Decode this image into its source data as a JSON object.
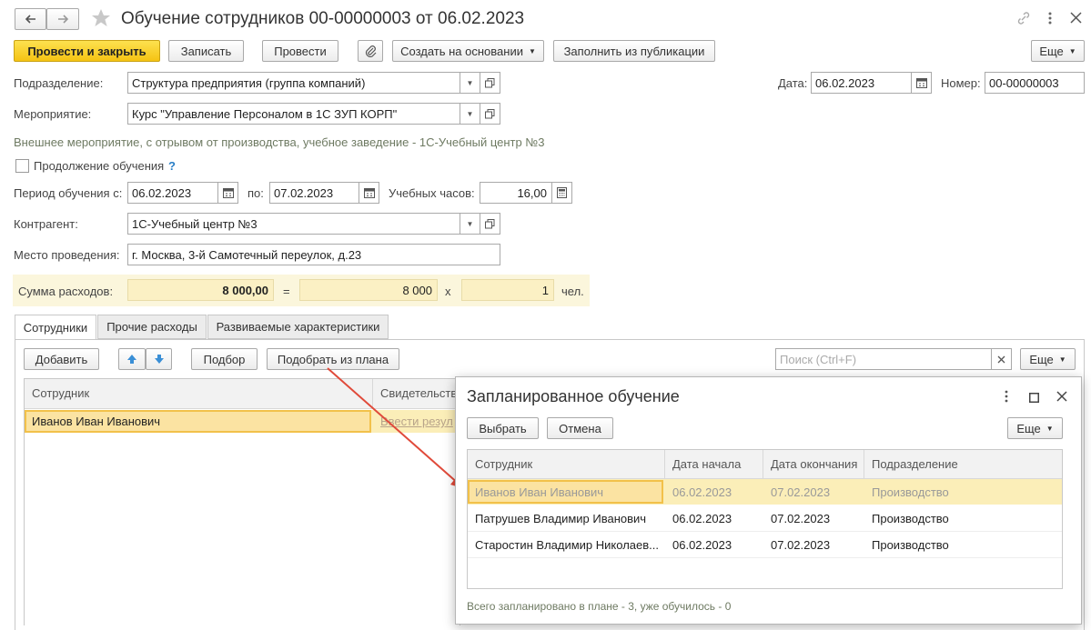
{
  "window": {
    "title": "Обучение сотрудников 00-00000003 от 06.02.2023"
  },
  "toolbar": {
    "post_close": "Провести и закрыть",
    "save": "Записать",
    "post": "Провести",
    "create_based": "Создать на основании",
    "fill_publication": "Заполнить из публикации",
    "more": "Еще"
  },
  "form": {
    "subdivision_label": "Подразделение:",
    "subdivision_value": "Структура предприятия (группа компаний)",
    "date_label": "Дата:",
    "date_value": "06.02.2023",
    "number_label": "Номер:",
    "number_value": "00-00000003",
    "event_label": "Мероприятие:",
    "event_value": "Курс \"Управление Персоналом в 1С ЗУП КОРП\"",
    "event_note": "Внешнее мероприятие, с отрывом от производства, учебное заведение - 1С-Учебный центр №3",
    "continuation_label": "Продолжение обучения",
    "help": "?",
    "period_label": "Период обучения с:",
    "period_from": "06.02.2023",
    "period_to_label": "по:",
    "period_to": "07.02.2023",
    "hours_label": "Учебных часов:",
    "hours_value": "16,00",
    "contractor_label": "Контрагент:",
    "contractor_value": "1С-Учебный центр №3",
    "place_label": "Место проведения:",
    "place_value": "г. Москва, 3-й Самотечный переулок, д.23",
    "cost_label": "Сумма расходов:",
    "cost_total": "8 000,00",
    "eq": "=",
    "cost_per": "8 000",
    "times": "x",
    "people": "1",
    "people_unit": "чел."
  },
  "tabs": [
    "Сотрудники",
    "Прочие расходы",
    "Развиваемые характеристики"
  ],
  "employees_panel": {
    "add": "Добавить",
    "pick": "Подбор",
    "pick_plan": "Подобрать из плана",
    "search_placeholder": "Поиск (Ctrl+F)",
    "more": "Еще",
    "col_employee": "Сотрудник",
    "col_certificate": "Свидетельство",
    "row_employee": "Иванов Иван Иванович",
    "row_certificate": "Ввести резул"
  },
  "dialog": {
    "title": "Запланированное обучение",
    "select": "Выбрать",
    "cancel": "Отмена",
    "more": "Еще",
    "columns": [
      "Сотрудник",
      "Дата начала",
      "Дата окончания",
      "Подразделение"
    ],
    "rows": [
      [
        "Иванов Иван Иванович",
        "06.02.2023",
        "07.02.2023",
        "Производство"
      ],
      [
        "Патрушев Владимир Иванович",
        "06.02.2023",
        "07.02.2023",
        "Производство"
      ],
      [
        "Старостин Владимир Николаев...",
        "06.02.2023",
        "07.02.2023",
        "Производство"
      ]
    ],
    "footer": "Всего запланировано в плане - 3, уже обучилось - 0"
  },
  "colors": {
    "accent_yellow": "#f5c313",
    "selected_row": "#fbeeb8",
    "arrow": "#e04a3a",
    "note_green": "#6e7a62"
  }
}
